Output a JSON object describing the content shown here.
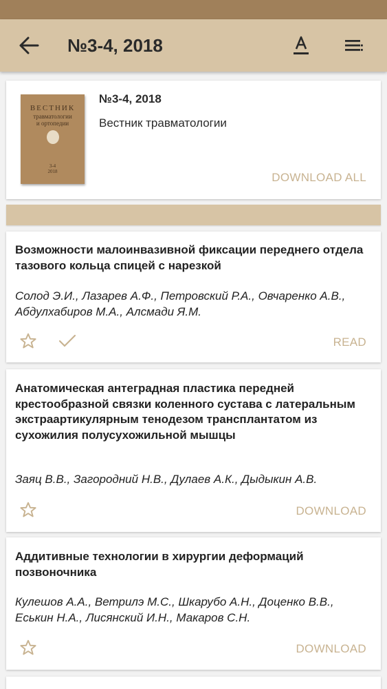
{
  "app_bar": {
    "title": "№3-4, 2018",
    "back_icon": "arrow-left-icon",
    "font_icon": "font-size-icon",
    "menu_icon": "list-menu-icon",
    "color": "#d7c4a5"
  },
  "issue": {
    "number": "№3-4, 2018",
    "journal": "Вестник травматологии",
    "download_all_label": "DOWNLOAD ALL",
    "cover": {
      "title_line1": "ВЕСТНИК",
      "title_line2": "травматологии",
      "title_line3": "и ортопедии",
      "number": "3-4",
      "year": "2018"
    }
  },
  "articles": [
    {
      "title": "Возможности малоинвазивной фиксации переднего отдела тазового кольца спицей с нарезкой",
      "authors": "Солод Э.И., Лазарев А.Ф., Петровский Р.А., Овчаренко А.В., Абдулхабиров М.А., Алсмади Я.М.",
      "action_label": "READ",
      "downloaded": true
    },
    {
      "title": "Анатомическая антеградная пластика передней крестообразной связки коленного сустава с латеральным экстраартикулярным тенодезом трансплантатом из сухожилия полусухожильной мышцы",
      "authors": "Заяц В.В., Загородний Н.В., Дулаев А.К., Дыдыкин А.В.",
      "action_label": "DOWNLOAD",
      "downloaded": false
    },
    {
      "title": "Аддитивные технологии в хирургии деформаций позвоночника",
      "authors": "Кулешов А.А., Ветрилэ М.С., Шкарубо А.Н., Доценко В.В., Еськин Н.А., Лисянский И.Н., Макаров С.Н.",
      "action_label": "DOWNLOAD",
      "downloaded": false
    }
  ],
  "colors": {
    "accent": "#c8b391",
    "status_bar": "#a0805a",
    "header": "#d7c4a5"
  }
}
